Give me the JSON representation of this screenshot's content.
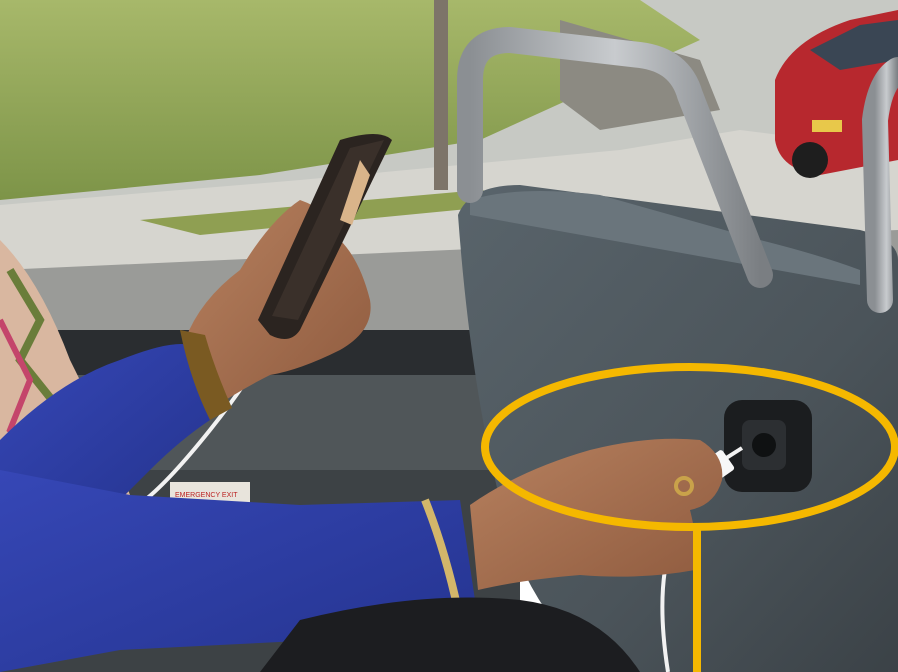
{
  "scene": {
    "photo_description_icon": "photo-scene-icon",
    "sticker_text": "EMERGENCY EXIT",
    "colors": {
      "highlight": "#F5B800",
      "sleeve": "#2E3FA8",
      "seat": "#4A5156",
      "grass": "#8EA24E"
    }
  }
}
